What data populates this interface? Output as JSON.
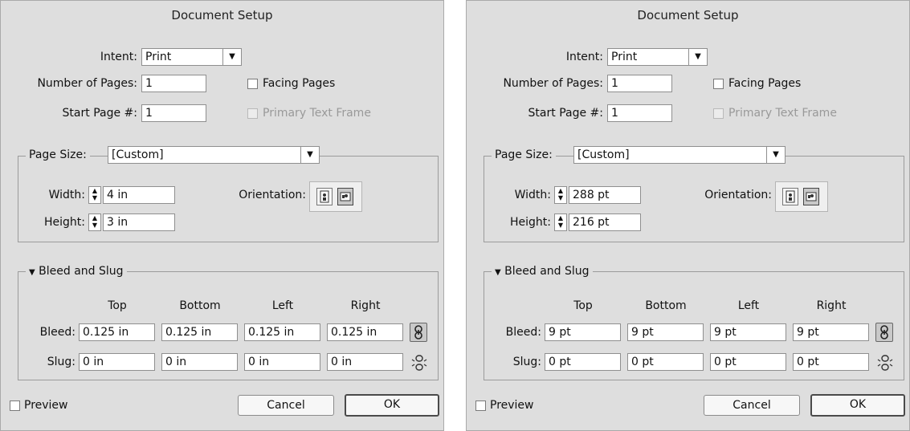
{
  "dialogs": [
    {
      "title": "Document Setup",
      "intent_label": "Intent:",
      "intent_value": "Print",
      "pages_label": "Number of Pages:",
      "pages_value": "1",
      "start_label": "Start Page #:",
      "start_value": "1",
      "facing_label": "Facing Pages",
      "facing_checked": false,
      "primary_label": "Primary Text Frame",
      "primary_disabled": true,
      "page_size_label": "Page Size:",
      "page_size_value": "[Custom]",
      "width_label": "Width:",
      "width_value": "4 in",
      "height_label": "Height:",
      "height_value": "3 in",
      "orientation_label": "Orientation:",
      "orientation_selected": "landscape",
      "bleed_section": "Bleed and Slug",
      "col_top": "Top",
      "col_bottom": "Bottom",
      "col_left": "Left",
      "col_right": "Right",
      "bleed_label": "Bleed:",
      "bleed": [
        "0.125 in",
        "0.125 in",
        "0.125 in",
        "0.125 in"
      ],
      "slug_label": "Slug:",
      "slug": [
        "0 in",
        "0 in",
        "0 in",
        "0 in"
      ],
      "preview_label": "Preview",
      "cancel_label": "Cancel",
      "ok_label": "OK"
    },
    {
      "title": "Document Setup",
      "intent_label": "Intent:",
      "intent_value": "Print",
      "pages_label": "Number of Pages:",
      "pages_value": "1",
      "start_label": "Start Page #:",
      "start_value": "1",
      "facing_label": "Facing Pages",
      "facing_checked": false,
      "primary_label": "Primary Text Frame",
      "primary_disabled": true,
      "page_size_label": "Page Size:",
      "page_size_value": "[Custom]",
      "width_label": "Width:",
      "width_value": "288 pt",
      "height_label": "Height:",
      "height_value": "216 pt",
      "orientation_label": "Orientation:",
      "orientation_selected": "landscape",
      "bleed_section": "Bleed and Slug",
      "col_top": "Top",
      "col_bottom": "Bottom",
      "col_left": "Left",
      "col_right": "Right",
      "bleed_label": "Bleed:",
      "bleed": [
        "9 pt",
        "9 pt",
        "9 pt",
        "9 pt"
      ],
      "slug_label": "Slug:",
      "slug": [
        "0 pt",
        "0 pt",
        "0 pt",
        "0 pt"
      ],
      "preview_label": "Preview",
      "cancel_label": "Cancel",
      "ok_label": "OK"
    }
  ],
  "colors": {
    "dialog_background": "#dedede",
    "field_background": "#ffffff",
    "border": "#8f8f8f"
  }
}
